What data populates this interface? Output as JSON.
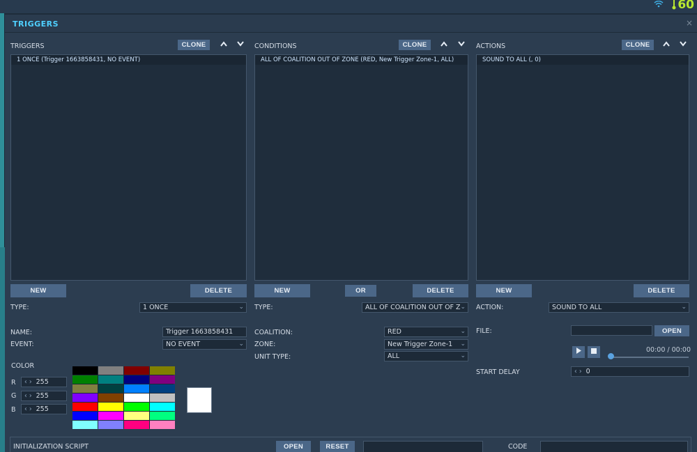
{
  "topbar": {
    "fps": "60"
  },
  "window": {
    "title": "TRIGGERS",
    "close_label": "×"
  },
  "triggers": {
    "header": "TRIGGERS",
    "clone": "CLONE",
    "items": [
      "1 ONCE (Trigger 1663858431, NO EVENT)"
    ],
    "new": "NEW",
    "delete": "DELETE",
    "type_label": "TYPE:",
    "type_value": "1 ONCE",
    "name_label": "NAME:",
    "name_value": "Trigger 1663858431",
    "event_label": "EVENT:",
    "event_value": "NO EVENT",
    "color_label": "COLOR",
    "r_label": "R",
    "r_value": "255",
    "g_label": "G",
    "g_value": "255",
    "b_label": "B",
    "b_value": "255",
    "palette": [
      "#000000",
      "#808080",
      "#800000",
      "#808000",
      "#008000",
      "#008080",
      "#000080",
      "#800080",
      "#808040",
      "#004040",
      "#0080ff",
      "#004080",
      "#8000ff",
      "#804000",
      "#ffffff",
      "#c0c0c0",
      "#ff0000",
      "#ffff00",
      "#00ff00",
      "#00ffff",
      "#0000ff",
      "#ff00ff",
      "#ffff80",
      "#00ff80",
      "#80ffff",
      "#8080ff",
      "#ff0080",
      "#ff80c0"
    ]
  },
  "conditions": {
    "header": "CONDITIONS",
    "clone": "CLONE",
    "items": [
      "ALL OF COALITION OUT OF ZONE (RED, New Trigger Zone-1, ALL)"
    ],
    "new": "NEW",
    "or": "OR",
    "delete": "DELETE",
    "type_label": "TYPE:",
    "type_value": "ALL OF COALITION OUT OF Z",
    "coalition_label": "COALITION:",
    "coalition_value": "RED",
    "zone_label": "ZONE:",
    "zone_value": "New Trigger Zone-1",
    "unit_type_label": "UNIT TYPE:",
    "unit_type_value": "ALL"
  },
  "actions": {
    "header": "ACTIONS",
    "clone": "CLONE",
    "items": [
      "SOUND TO ALL (, 0)"
    ],
    "new": "NEW",
    "delete": "DELETE",
    "action_label": "ACTION:",
    "action_value": "SOUND TO ALL",
    "file_label": "FILE:",
    "file_value": "",
    "open": "OPEN",
    "time": "00:00 / 00:00",
    "start_delay_label": "START DELAY",
    "start_delay_value": "0"
  },
  "init_script": {
    "label": "INITIALIZATION SCRIPT",
    "open": "OPEN",
    "reset": "RESET",
    "code_label": "CODE"
  }
}
